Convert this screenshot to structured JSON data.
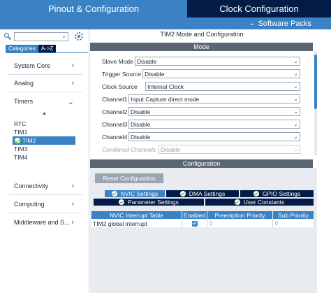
{
  "header": {
    "tab_pinout": "Pinout & Configuration",
    "tab_clock": "Clock Configuration",
    "software_packs": "Software Packs"
  },
  "sidebar": {
    "search_value": "",
    "tabs": {
      "categories": "Categories",
      "az": "A->Z"
    },
    "categories": {
      "system_core": "System Core",
      "analog": "Analog",
      "timers": "Timers",
      "connectivity": "Connectivity",
      "computing": "Computing",
      "middleware": "Middleware and S..."
    },
    "timers_items": [
      "RTC",
      "TIM1",
      "TIM2",
      "TIM3",
      "TIM4"
    ],
    "selected_item": "TIM2"
  },
  "main": {
    "title": "TIM2 Mode and Configuration",
    "mode_section": "Mode",
    "config_section": "Configuration",
    "mode_fields": {
      "slave_mode": {
        "label": "Slave Mode",
        "value": "Disable"
      },
      "trigger_source": {
        "label": "Trigger Source",
        "value": "Disable"
      },
      "clock_source": {
        "label": "Clock Source",
        "value": "Internal Clock"
      },
      "channel1": {
        "label": "Channel1",
        "value": "Input Capture direct mode"
      },
      "channel2": {
        "label": "Channel2",
        "value": "Disable"
      },
      "channel3": {
        "label": "Channel3",
        "value": "Disable"
      },
      "channel4": {
        "label": "Channel4",
        "value": "Disable"
      },
      "combined": {
        "label": "Combined Channels",
        "value": "Disable"
      }
    },
    "reset_button": "Reset Configuration",
    "config_tabs": {
      "nvic": "NVIC Settings",
      "dma": "DMA Settings",
      "gpio": "GPIO Settings",
      "parameter": "Parameter Settings",
      "user_constants": "User Constants"
    },
    "table": {
      "headers": {
        "name": "NVIC Interrupt Table",
        "enabled": "Enabled",
        "preemption": "Preemption Priority",
        "sub": "Sub Priority"
      },
      "rows": [
        {
          "name": "TIM2 global interrupt",
          "enabled": true,
          "preemption": "0",
          "sub": "0"
        }
      ]
    }
  },
  "colors": {
    "accent": "#3b82c4",
    "navy": "#031c47",
    "section_gray": "#5b6672",
    "check_green": "#2aa84a"
  }
}
